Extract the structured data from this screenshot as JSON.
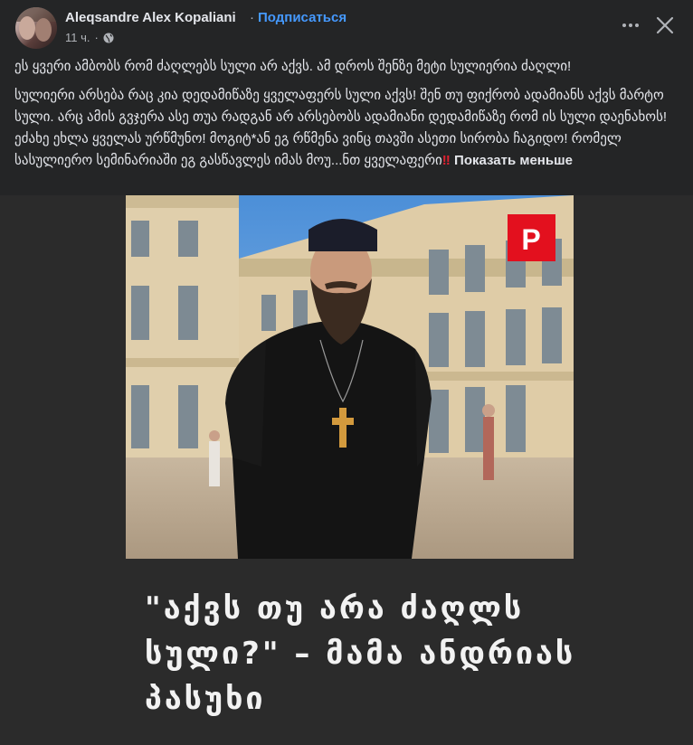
{
  "post": {
    "author": "Aleqsandre Alex Kopaliani",
    "separator": "·",
    "subscribe_label": "Подписаться",
    "time": "11 ч.",
    "dot": "·",
    "paragraph1": "ეს ყვერი ამბობს რომ ძაღლებს სული არ აქვს. ამ დროს შენზე მეტი სულიერია ძაღლი!",
    "paragraph2": "სულიერი არსება რაც კია დედამიწაზე ყველაფერს სული აქვს! შენ თუ ფიქრობ ადამიანს აქვს მარტო სული. არც ამის გვჯერა ასე თუა რადგან არ არსებობს ადამიანი დედამიწაზე რომ ის სული დაენახოს! ეძახე ეხლა ყველას ურწმუნო! მოგიტ*ან ეგ რწმენა ვინც თავში ასეთი სირობა ჩაგიდო! რომელ სასულიერო სემინარიაში ეგ გასწავლეს იმას მოუ...ნთ ყველაფერი",
    "emphasis": "‼",
    "show_less_label": "Показать меньше"
  },
  "image": {
    "badge_letter": "P",
    "caption_line1": "\"აქვს თუ არა ძაღლს",
    "caption_line2": "სული?\" – მამა ანდრიას",
    "caption_line3": "პასუხი"
  },
  "icons": {
    "globe": "globe-icon",
    "more": "more-options-icon",
    "close": "close-icon"
  },
  "colors": {
    "background": "#242526",
    "link": "#4599ff",
    "badge": "#e3101e"
  }
}
